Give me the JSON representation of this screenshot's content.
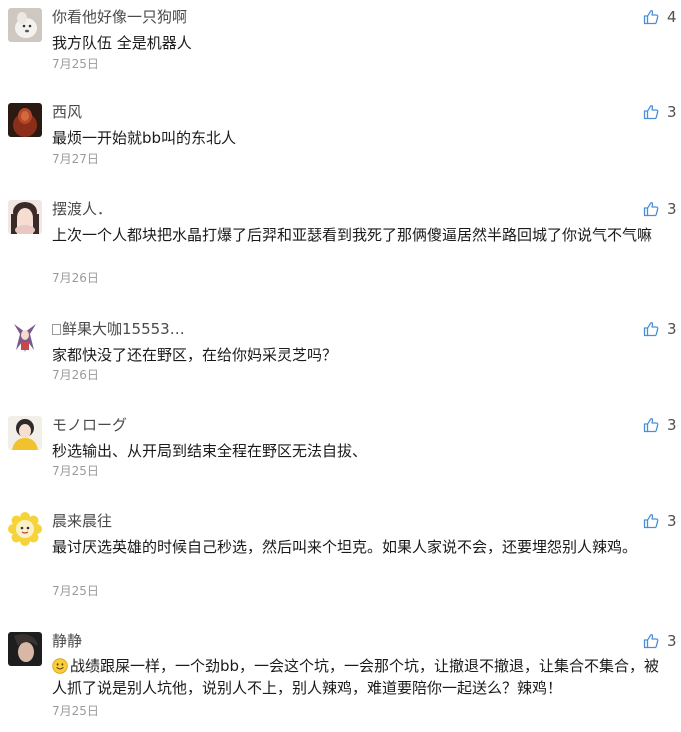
{
  "comments": [
    {
      "nickname": "你看他好像一只狗啊",
      "text": "我方队伍 全是机器人",
      "date": "7月25日",
      "likes": "4",
      "avatar_icon": "white-dog-avatar-icon"
    },
    {
      "nickname": "西风",
      "text": "最烦一开始就bb叫的东北人",
      "date": "7月27日",
      "likes": "3",
      "avatar_icon": "red-figure-avatar-icon"
    },
    {
      "nickname": "摆渡人．",
      "text": "上次一个人都块把水晶打爆了后羿和亚瑟看到我死了那俩傻逼居然半路回城了你说气不气嘛",
      "date": "7月26日",
      "likes": "3",
      "avatar_icon": "girl-portrait-avatar-icon"
    },
    {
      "nickname": "鲜果大咖15553…",
      "text": "家都快没了还在野区，在给你妈采灵芝吗？",
      "date": "7月26日",
      "likes": "3",
      "avatar_icon": "anime-character-avatar-icon"
    },
    {
      "nickname": "モノローグ",
      "text": "秒选输出、从开局到结束全程在野区无法自拔、",
      "date": "7月25日",
      "likes": "3",
      "avatar_icon": "girl-yellow-avatar-icon"
    },
    {
      "nickname": "晨来晨往",
      "text": "最讨厌选英雄的时候自己秒选，然后叫来个坦克。如果人家说不会，还要埋怨别人辣鸡。",
      "date": "7月25日",
      "likes": "3",
      "avatar_icon": "sunflower-avatar-icon"
    },
    {
      "nickname": "静静",
      "text": "战绩跟屎一样，一个劲bb，一会这个坑，一会那个坑，让撤退不撤退，让集合不集合，被人抓了说是别人坑他，说别人不上，别人辣鸡，难道要陪你一起送么？辣鸡！",
      "date": "7月25日",
      "likes": "3",
      "avatar_icon": "dark-hair-portrait-avatar-icon"
    }
  ],
  "colors": {
    "nickname": "#4a4a4a",
    "text": "#1a1a1a",
    "date": "#9b9b9b",
    "like_icon": "#4a90d9"
  }
}
